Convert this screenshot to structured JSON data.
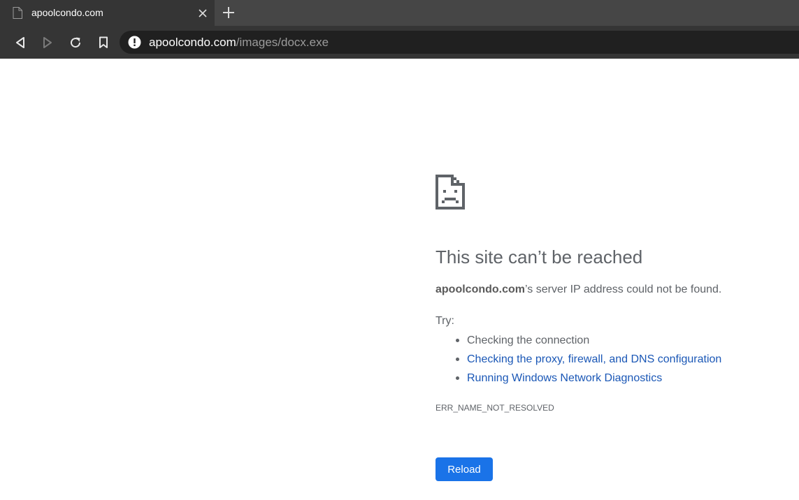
{
  "tab": {
    "title": "apoolcondo.com",
    "favicon": "page-icon",
    "close": "close-icon"
  },
  "new_tab": "plus-icon",
  "toolbar": {
    "back": "back-icon",
    "forward": "forward-icon",
    "reload": "reload-icon",
    "bookmark": "bookmark-icon"
  },
  "omnibox": {
    "security_icon": "info-icon",
    "url_host": "apoolcondo.com",
    "url_path": "/images/docx.exe"
  },
  "error": {
    "icon": "sad-page-icon",
    "heading": "This site can’t be reached",
    "summary_host": "apoolcondo.com",
    "summary_rest": "’s server IP address could not be found.",
    "try_label": "Try:",
    "suggestions": [
      {
        "text": "Checking the connection",
        "link": false
      },
      {
        "text": "Checking the proxy, firewall, and DNS configuration",
        "link": true
      },
      {
        "text": "Running Windows Network Diagnostics",
        "link": true
      }
    ],
    "code": "ERR_NAME_NOT_RESOLVED",
    "reload_label": "Reload"
  },
  "colors": {
    "chrome_dark": "#353535",
    "tabstrip": "#464646",
    "omnibox": "#202020",
    "link": "#1a57b6",
    "button": "#1a73e8",
    "text": "#5f6368"
  }
}
